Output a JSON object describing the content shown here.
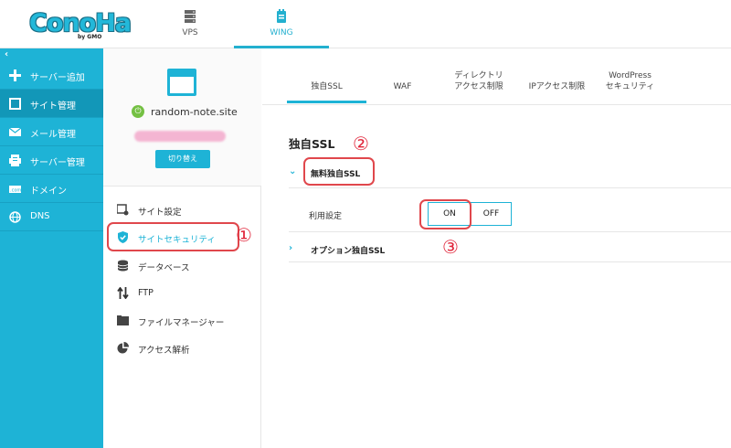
{
  "header": {
    "logo_text": "ConoHa",
    "logo_sub": "by GMO",
    "nav": [
      {
        "label": "VPS",
        "icon": "server-icon"
      },
      {
        "label": "WING",
        "icon": "wing-icon"
      }
    ],
    "active_nav": "WING"
  },
  "sidebar": {
    "collapse_icon": "‹",
    "items": [
      {
        "label": "サーバー追加",
        "icon": "plus-icon"
      },
      {
        "label": "サイト管理",
        "icon": "window-icon"
      },
      {
        "label": "メール管理",
        "icon": "mail-icon"
      },
      {
        "label": "サーバー管理",
        "icon": "server-manage-icon"
      },
      {
        "label": "ドメイン",
        "icon": "domain-icon"
      },
      {
        "label": "DNS",
        "icon": "globe-icon"
      }
    ],
    "active": "サイト管理"
  },
  "site": {
    "name": "random-note.site",
    "switch_label": "切り替え"
  },
  "site_menu": [
    {
      "label": "サイト設定",
      "icon": "site-settings-icon"
    },
    {
      "label": "サイトセキュリティ",
      "icon": "shield-icon"
    },
    {
      "label": "データベース",
      "icon": "database-icon"
    },
    {
      "label": "FTP",
      "icon": "transfer-icon"
    },
    {
      "label": "ファイルマネージャー",
      "icon": "folder-icon"
    },
    {
      "label": "アクセス解析",
      "icon": "pie-chart-icon"
    }
  ],
  "annotations": {
    "one": "①",
    "two": "②",
    "three": "③"
  },
  "tabs": [
    {
      "line1": "独自SSL",
      "line2": ""
    },
    {
      "line1": "WAF",
      "line2": ""
    },
    {
      "line1": "ディレクトリ",
      "line2": "アクセス制限"
    },
    {
      "line1": "IPアクセス制限",
      "line2": ""
    },
    {
      "line1": "WordPress",
      "line2": "セキュリティ"
    }
  ],
  "main": {
    "section_title": "独自SSL",
    "free_ssl_label": "無料独自SSL",
    "field_label": "利用設定",
    "toggle_on": "ON",
    "toggle_off": "OFF",
    "option_ssl_label": "オプション独自SSL"
  },
  "colors": {
    "accent": "#1eb3d6",
    "highlight": "#e0474c"
  }
}
